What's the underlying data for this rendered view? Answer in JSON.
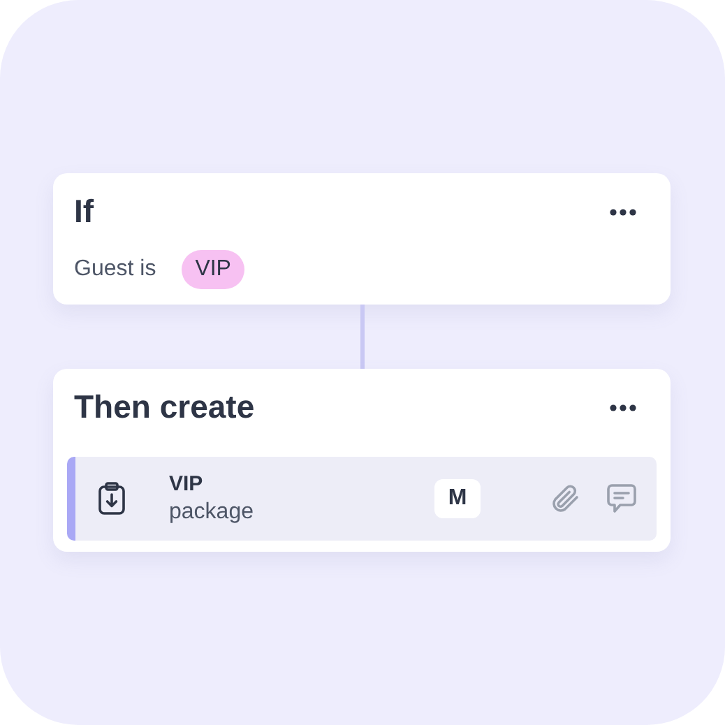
{
  "condition": {
    "title": "If",
    "label": "Guest is",
    "tag": "VIP"
  },
  "action": {
    "title": "Then create",
    "item": {
      "title": "VIP",
      "subtitle": "package",
      "badge": "M"
    }
  }
}
